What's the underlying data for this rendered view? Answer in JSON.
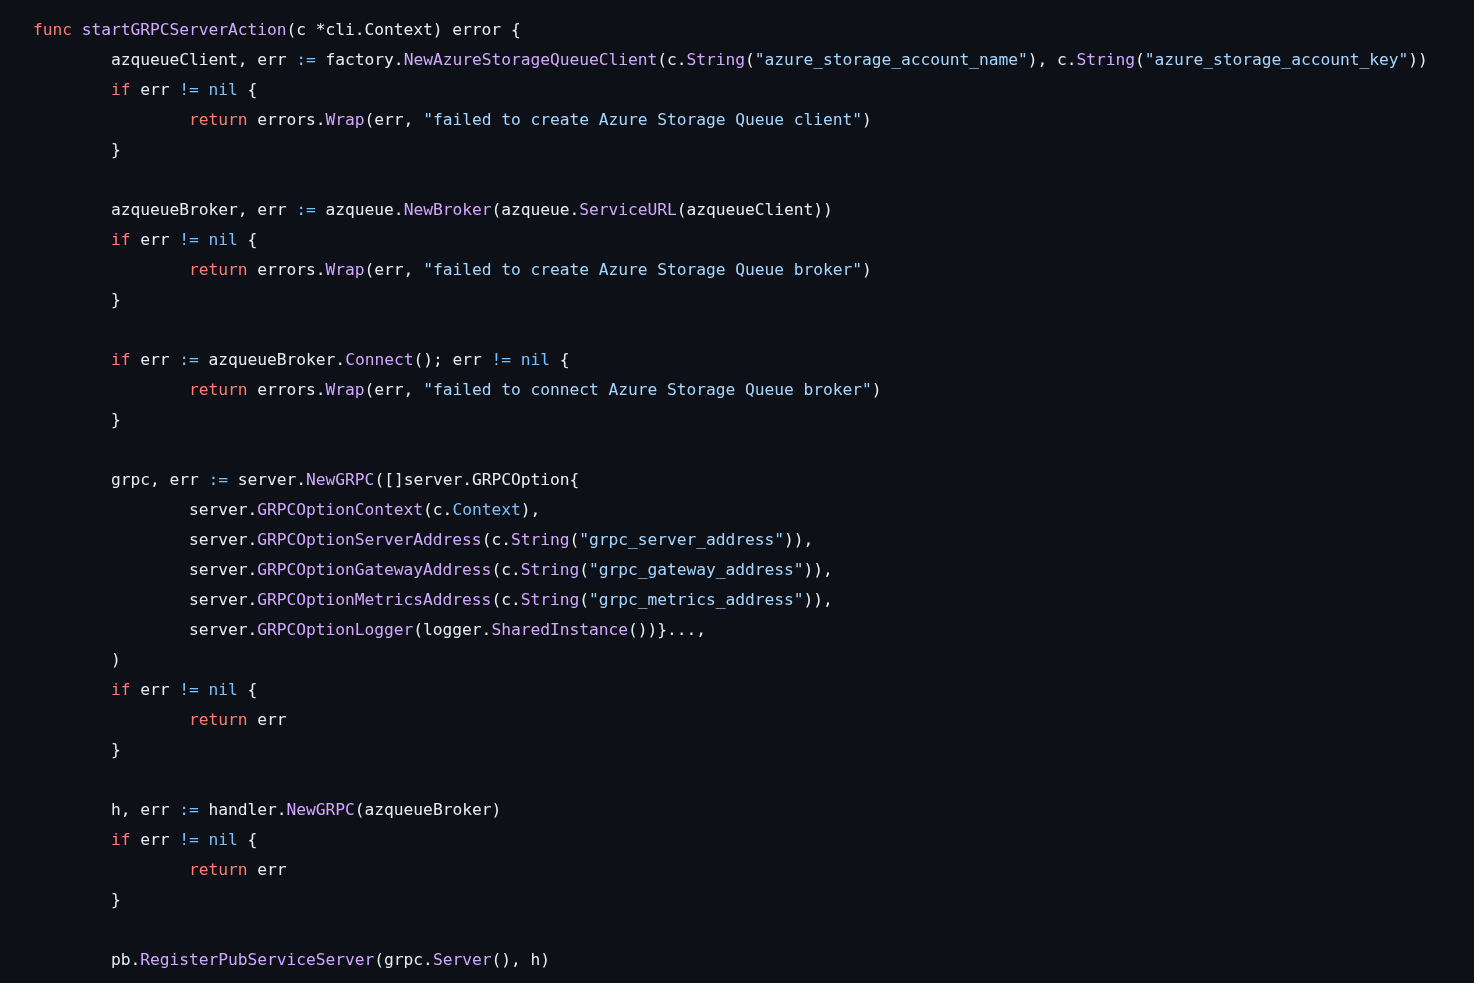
{
  "code": {
    "lines": [
      {
        "kind": "code",
        "tokens": [
          {
            "kind": "kw",
            "t": "func"
          },
          {
            "kind": "fn",
            "t": " startGRPCServerAction"
          },
          {
            "kind": "p",
            "t": "(c *cli.Context) error {"
          }
        ]
      },
      {
        "kind": "code",
        "tokens": [
          {
            "kind": "p",
            "t": "\tazqueueClient, err "
          },
          {
            "kind": "op",
            "t": ":="
          },
          {
            "kind": "p",
            "t": " factory."
          },
          {
            "kind": "fn",
            "t": "NewAzureStorageQueueClient"
          },
          {
            "kind": "p",
            "t": "(c."
          },
          {
            "kind": "fn",
            "t": "String"
          },
          {
            "kind": "p",
            "t": "("
          },
          {
            "kind": "str",
            "t": "\"azure_storage_account_name\""
          },
          {
            "kind": "p",
            "t": "), c."
          },
          {
            "kind": "fn",
            "t": "String"
          },
          {
            "kind": "p",
            "t": "("
          },
          {
            "kind": "str",
            "t": "\"azure_storage_account_key\""
          },
          {
            "kind": "p",
            "t": "))"
          }
        ]
      },
      {
        "kind": "code",
        "tokens": [
          {
            "kind": "kw",
            "t": "\tif"
          },
          {
            "kind": "p",
            "t": " err "
          },
          {
            "kind": "op",
            "t": "!= nil"
          },
          {
            "kind": "p",
            "t": " {"
          }
        ]
      },
      {
        "kind": "code",
        "tokens": [
          {
            "kind": "kw",
            "t": "\t\treturn"
          },
          {
            "kind": "p",
            "t": " errors."
          },
          {
            "kind": "fn",
            "t": "Wrap"
          },
          {
            "kind": "p",
            "t": "(err, "
          },
          {
            "kind": "str",
            "t": "\"failed to create Azure Storage Queue client\""
          },
          {
            "kind": "p",
            "t": ")"
          }
        ]
      },
      {
        "kind": "code",
        "tokens": [
          {
            "kind": "p",
            "t": "\t}"
          }
        ]
      },
      {
        "kind": "blank"
      },
      {
        "kind": "code",
        "tokens": [
          {
            "kind": "p",
            "t": "\tazqueueBroker, err "
          },
          {
            "kind": "op",
            "t": ":="
          },
          {
            "kind": "p",
            "t": " azqueue."
          },
          {
            "kind": "fn",
            "t": "NewBroker"
          },
          {
            "kind": "p",
            "t": "(azqueue."
          },
          {
            "kind": "fn",
            "t": "ServiceURL"
          },
          {
            "kind": "p",
            "t": "(azqueueClient))"
          }
        ]
      },
      {
        "kind": "code",
        "tokens": [
          {
            "kind": "kw",
            "t": "\tif"
          },
          {
            "kind": "p",
            "t": " err "
          },
          {
            "kind": "op",
            "t": "!= nil"
          },
          {
            "kind": "p",
            "t": " {"
          }
        ]
      },
      {
        "kind": "code",
        "tokens": [
          {
            "kind": "kw",
            "t": "\t\treturn"
          },
          {
            "kind": "p",
            "t": " errors."
          },
          {
            "kind": "fn",
            "t": "Wrap"
          },
          {
            "kind": "p",
            "t": "(err, "
          },
          {
            "kind": "str",
            "t": "\"failed to create Azure Storage Queue broker\""
          },
          {
            "kind": "p",
            "t": ")"
          }
        ]
      },
      {
        "kind": "code",
        "tokens": [
          {
            "kind": "p",
            "t": "\t}"
          }
        ]
      },
      {
        "kind": "blank"
      },
      {
        "kind": "code",
        "tokens": [
          {
            "kind": "kw",
            "t": "\tif"
          },
          {
            "kind": "p",
            "t": " err "
          },
          {
            "kind": "op",
            "t": ":="
          },
          {
            "kind": "p",
            "t": " azqueueBroker."
          },
          {
            "kind": "fn",
            "t": "Connect"
          },
          {
            "kind": "p",
            "t": "(); err "
          },
          {
            "kind": "op",
            "t": "!= nil"
          },
          {
            "kind": "p",
            "t": " {"
          }
        ]
      },
      {
        "kind": "code",
        "tokens": [
          {
            "kind": "kw",
            "t": "\t\treturn"
          },
          {
            "kind": "p",
            "t": " errors."
          },
          {
            "kind": "fn",
            "t": "Wrap"
          },
          {
            "kind": "p",
            "t": "(err, "
          },
          {
            "kind": "str",
            "t": "\"failed to connect Azure Storage Queue broker\""
          },
          {
            "kind": "p",
            "t": ")"
          }
        ]
      },
      {
        "kind": "code",
        "tokens": [
          {
            "kind": "p",
            "t": "\t}"
          }
        ]
      },
      {
        "kind": "blank"
      },
      {
        "kind": "code",
        "tokens": [
          {
            "kind": "p",
            "t": "\tgrpc, err "
          },
          {
            "kind": "op",
            "t": ":="
          },
          {
            "kind": "p",
            "t": " server."
          },
          {
            "kind": "fn",
            "t": "NewGRPC"
          },
          {
            "kind": "p",
            "t": "([]server.GRPCOption{"
          }
        ]
      },
      {
        "kind": "code",
        "tokens": [
          {
            "kind": "p",
            "t": "\t\tserver."
          },
          {
            "kind": "fn",
            "t": "GRPCOptionContext"
          },
          {
            "kind": "p",
            "t": "(c."
          },
          {
            "kind": "op",
            "t": "Context"
          },
          {
            "kind": "p",
            "t": "),"
          }
        ]
      },
      {
        "kind": "code",
        "tokens": [
          {
            "kind": "p",
            "t": "\t\tserver."
          },
          {
            "kind": "fn",
            "t": "GRPCOptionServerAddress"
          },
          {
            "kind": "p",
            "t": "(c."
          },
          {
            "kind": "fn",
            "t": "String"
          },
          {
            "kind": "p",
            "t": "("
          },
          {
            "kind": "str",
            "t": "\"grpc_server_address\""
          },
          {
            "kind": "p",
            "t": ")),"
          }
        ]
      },
      {
        "kind": "code",
        "tokens": [
          {
            "kind": "p",
            "t": "\t\tserver."
          },
          {
            "kind": "fn",
            "t": "GRPCOptionGatewayAddress"
          },
          {
            "kind": "p",
            "t": "(c."
          },
          {
            "kind": "fn",
            "t": "String"
          },
          {
            "kind": "p",
            "t": "("
          },
          {
            "kind": "str",
            "t": "\"grpc_gateway_address\""
          },
          {
            "kind": "p",
            "t": ")),"
          }
        ]
      },
      {
        "kind": "code",
        "tokens": [
          {
            "kind": "p",
            "t": "\t\tserver."
          },
          {
            "kind": "fn",
            "t": "GRPCOptionMetricsAddress"
          },
          {
            "kind": "p",
            "t": "(c."
          },
          {
            "kind": "fn",
            "t": "String"
          },
          {
            "kind": "p",
            "t": "("
          },
          {
            "kind": "str",
            "t": "\"grpc_metrics_address\""
          },
          {
            "kind": "p",
            "t": ")),"
          }
        ]
      },
      {
        "kind": "code",
        "tokens": [
          {
            "kind": "p",
            "t": "\t\tserver."
          },
          {
            "kind": "fn",
            "t": "GRPCOptionLogger"
          },
          {
            "kind": "p",
            "t": "(logger."
          },
          {
            "kind": "fn",
            "t": "SharedInstance"
          },
          {
            "kind": "p",
            "t": "())}...,"
          }
        ]
      },
      {
        "kind": "code",
        "tokens": [
          {
            "kind": "p",
            "t": "\t)"
          }
        ]
      },
      {
        "kind": "code",
        "tokens": [
          {
            "kind": "kw",
            "t": "\tif"
          },
          {
            "kind": "p",
            "t": " err "
          },
          {
            "kind": "op",
            "t": "!= nil"
          },
          {
            "kind": "p",
            "t": " {"
          }
        ]
      },
      {
        "kind": "code",
        "tokens": [
          {
            "kind": "kw",
            "t": "\t\treturn"
          },
          {
            "kind": "p",
            "t": " err"
          }
        ]
      },
      {
        "kind": "code",
        "tokens": [
          {
            "kind": "p",
            "t": "\t}"
          }
        ]
      },
      {
        "kind": "blank"
      },
      {
        "kind": "code",
        "tokens": [
          {
            "kind": "p",
            "t": "\th, err "
          },
          {
            "kind": "op",
            "t": ":="
          },
          {
            "kind": "p",
            "t": " handler."
          },
          {
            "kind": "fn",
            "t": "NewGRPC"
          },
          {
            "kind": "p",
            "t": "(azqueueBroker)"
          }
        ]
      },
      {
        "kind": "code",
        "tokens": [
          {
            "kind": "kw",
            "t": "\tif"
          },
          {
            "kind": "p",
            "t": " err "
          },
          {
            "kind": "op",
            "t": "!= nil"
          },
          {
            "kind": "p",
            "t": " {"
          }
        ]
      },
      {
        "kind": "code",
        "tokens": [
          {
            "kind": "kw",
            "t": "\t\treturn"
          },
          {
            "kind": "p",
            "t": " err"
          }
        ]
      },
      {
        "kind": "code",
        "tokens": [
          {
            "kind": "p",
            "t": "\t}"
          }
        ]
      },
      {
        "kind": "blank"
      },
      {
        "kind": "code",
        "tokens": [
          {
            "kind": "p",
            "t": "\tpb."
          },
          {
            "kind": "fn",
            "t": "RegisterPubServiceServer"
          },
          {
            "kind": "p",
            "t": "(grpc."
          },
          {
            "kind": "fn",
            "t": "Server"
          },
          {
            "kind": "p",
            "t": "(), h)"
          }
        ]
      }
    ]
  }
}
